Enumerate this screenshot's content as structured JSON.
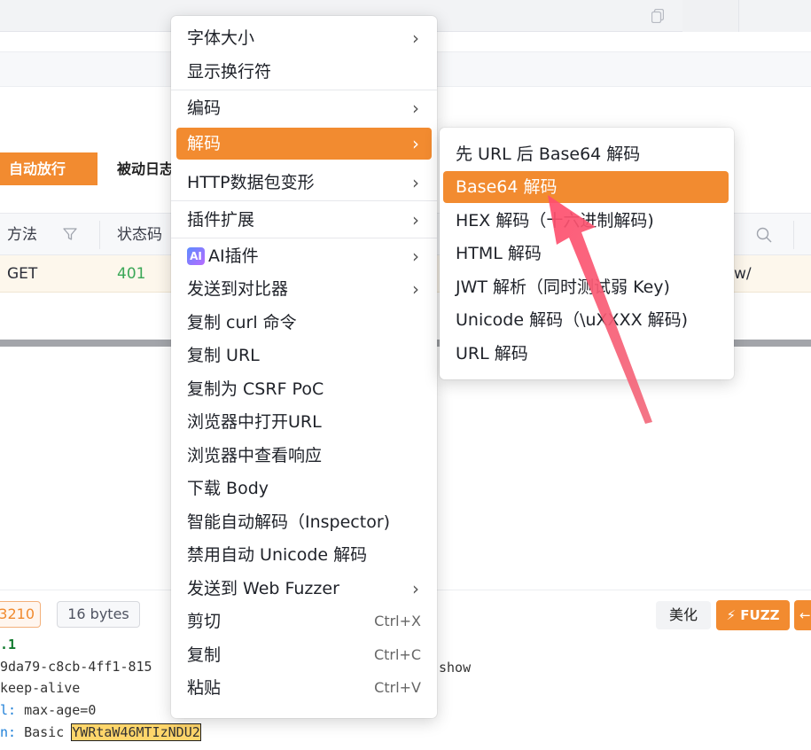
{
  "background": {
    "tabs": {
      "active": "自动放行",
      "inactive": "被动日志"
    },
    "table": {
      "headers": {
        "method": "方法",
        "status": "状态码"
      },
      "row": {
        "method": "GET",
        "status": "401",
        "url_tail": "w/"
      }
    },
    "request": {
      "status_tag": "3210",
      "size_tag": "16 bytes",
      "beautify_button": "美化",
      "fuzz_button": "FUZZ",
      "lines": {
        "l1_prefix": ".1",
        "l2": "9da79-c8cb-4ff1-815",
        "l2_right": "show",
        "l3": "keep-alive",
        "l4_key": "l:",
        "l4_val": " max-age=0",
        "l5_key": "n:",
        "l5_pre": " Basic ",
        "l5_hl": "YWRtaW46MTIzNDU2"
      }
    }
  },
  "context_menu": {
    "items": {
      "font_size": "字体大小",
      "show_newline": "显示换行符",
      "encode": "编码",
      "decode": "解码",
      "http_transform": "HTTP数据包变形",
      "plugin_ext": "插件扩展",
      "ai_badge": "AI",
      "ai_plugin": "AI插件",
      "send_compare": "发送到对比器",
      "copy_curl": "复制 curl 命令",
      "copy_url": "复制 URL",
      "copy_csrf": "复制为 CSRF PoC",
      "open_in_browser": "浏览器中打开URL",
      "view_response_browser": "浏览器中查看响应",
      "download_body": "下载 Body",
      "smart_decode": "智能自动解码（Inspector)",
      "disable_unicode": "禁用自动 Unicode 解码",
      "send_webfuzzer": "发送到 Web Fuzzer",
      "cut": "剪切",
      "copy": "复制",
      "paste": "粘贴"
    },
    "shortcuts": {
      "cut": "Ctrl+X",
      "copy": "Ctrl+C",
      "paste": "Ctrl+V"
    },
    "arrow_glyph": "›"
  },
  "decode_submenu": {
    "items": [
      "先 URL 后 Base64 解码",
      "Base64 解码",
      "HEX 解码（十六进制解码)",
      "HTML 解码",
      "JWT 解析（同时测试弱 Key)",
      "Unicode 解码（\\uXXXX 解码)",
      "URL 解码"
    ],
    "selected_index": 1
  },
  "colors": {
    "accent": "#f28b30",
    "pointer_arrow": "#f2546a"
  },
  "icons": [
    "copy-icon",
    "filter-icon",
    "search-icon",
    "lightning-icon",
    "chevron-right-icon",
    "ai-icon"
  ]
}
